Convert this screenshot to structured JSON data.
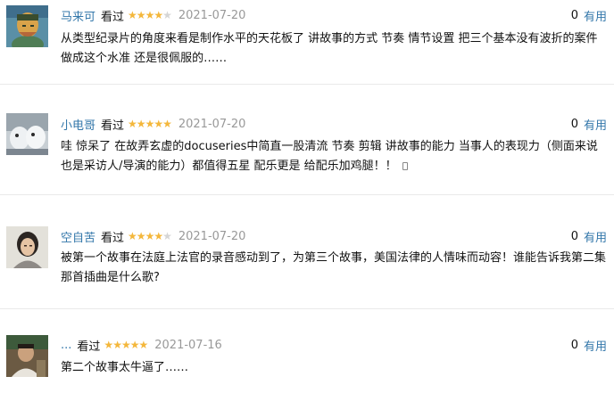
{
  "reviews": [
    {
      "author": "马来可",
      "status": "看过",
      "rating": 4,
      "date": "2021-07-20",
      "useful_count": "0",
      "useful_label": "有用",
      "text": "从类型纪录片的角度来看是制作水平的天花板了 讲故事的方式 节奏 情节设置 把三个基本没有波折的案件做成这个水准 还是很佩服的……"
    },
    {
      "author": "小电哥",
      "status": "看过",
      "rating": 5,
      "date": "2021-07-20",
      "useful_count": "0",
      "useful_label": "有用",
      "text": "哇 惊呆了 在故弄玄虚的docuseries中简直一股清流 节奏 剪辑 讲故事的能力 当事人的表现力（侧面来说也是采访人/导演的能力）都值得五星 配乐更是 给配乐加鸡腿！！",
      "icon": "mobile-icon"
    },
    {
      "author": "空自苦",
      "status": "看过",
      "rating": 4,
      "date": "2021-07-20",
      "useful_count": "0",
      "useful_label": "有用",
      "text": "被第一个故事在法庭上法官的录音感动到了，为第三个故事，美国法律的人情味而动容！谁能告诉我第二集那首插曲是什么歌?"
    },
    {
      "author": "...",
      "status": "看过",
      "rating": 5,
      "date": "2021-07-16",
      "useful_count": "0",
      "useful_label": "有用",
      "text": "第二个故事太牛逼了……"
    }
  ]
}
